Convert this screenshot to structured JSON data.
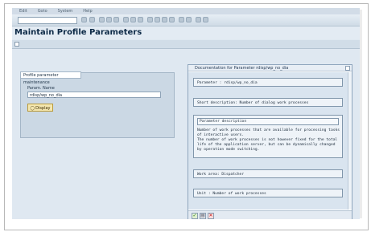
{
  "menu": [
    "Edit",
    "Goto",
    "System",
    "Help"
  ],
  "title": "Maintain Profile Parameters",
  "panel": {
    "tab_label": "Profile parameter maintenance",
    "param_label": "Param. Name",
    "param_value": "rdisp/wp_no_dia",
    "display_button": "Display"
  },
  "dialog": {
    "title": "Documentation for Parameter rdisp/wp_no_dia",
    "parameter": "Parameter : rdisp/wp_no_dia",
    "short_description": "Short description: Number of dialog work processes",
    "desc_header": "Parameter description",
    "desc_lines": [
      "Number of work processes that are available for processing tasks",
      "of interactive users.",
      "The number of work processes is not however fixed for the total",
      "life of the application server, but can be dynamically changed",
      "by operation mode switching."
    ],
    "work_area": "Work area: Dispatcher",
    "unit": "Unit : Number of work processes"
  },
  "colors": {
    "background": "#dfe8f1",
    "title": "#0d2a47",
    "button": "#f4e7b0"
  }
}
